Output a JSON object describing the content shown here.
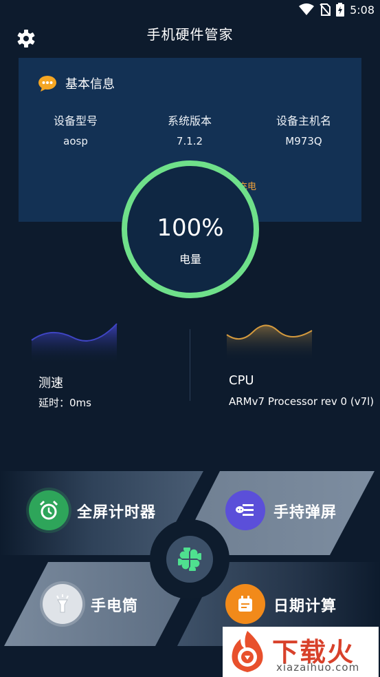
{
  "status": {
    "time": "5:08",
    "icons": [
      "wifi-icon",
      "no-sim-icon",
      "battery-charging-icon"
    ]
  },
  "header": {
    "title": "手机硬件管家",
    "settings_icon": "gear-icon"
  },
  "basic_info": {
    "title": "基本信息",
    "icon": "chat-bubble-icon",
    "items": [
      {
        "label": "设备型号",
        "value": "aosp"
      },
      {
        "label": "系统版本",
        "value": "7.1.2"
      },
      {
        "label": "设备主机名",
        "value": "M973Q"
      }
    ],
    "charging_text": "充电"
  },
  "battery": {
    "percent_text": "100%",
    "label": "电量",
    "level": 1.0,
    "ring_color": "#6fe08a"
  },
  "speed": {
    "title": "测速",
    "latency": "延时：0ms"
  },
  "cpu": {
    "title": "CPU",
    "info": "ARMv7 Processor rev 0 (v7l)"
  },
  "tools": [
    {
      "label": "全屏计时器",
      "icon": "alarm-clock-icon",
      "color": "#2ea55a"
    },
    {
      "label": "手持弹屏",
      "icon": "message-lines-icon",
      "color": "#5b4fd9"
    },
    {
      "label": "手电筒",
      "icon": "flashlight-icon",
      "color": "#dfe3e8"
    },
    {
      "label": "日期计算",
      "icon": "calendar-icon",
      "color": "#f28a1a"
    }
  ],
  "hub": {
    "icon": "clover-icon",
    "color": "#4fe08f"
  },
  "watermark": {
    "text": "下载火",
    "url": "xiazaihuo.com"
  },
  "colors": {
    "background": "#0d1b2d",
    "card": "#133154",
    "accent_orange": "#f0a23a"
  }
}
